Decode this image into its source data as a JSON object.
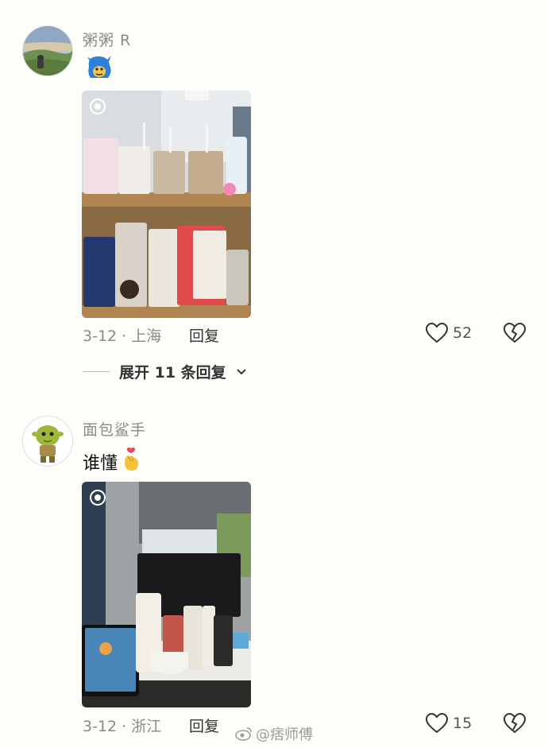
{
  "comments": [
    {
      "username": "粥粥 R",
      "text": "",
      "date": "3-12 · 上海",
      "reply_label": "回复",
      "likes": "52",
      "avatar_icon": "landscape-photo-avatar",
      "emoji_icon": "blue-cartoon-sticker-icon"
    },
    {
      "username": "面包鲨手",
      "text": "谁懂",
      "date": "3-12 · 浙江",
      "reply_label": "回复",
      "likes": "15",
      "avatar_icon": "green-ogre-avatar",
      "emoji_icon": "finger-heart-emoji-icon"
    }
  ],
  "expand_replies": "展开 11 条回复",
  "watermark": "@痞师傅",
  "colors": {
    "muted": "#8a8a8a",
    "background": "#fdfdf9"
  }
}
